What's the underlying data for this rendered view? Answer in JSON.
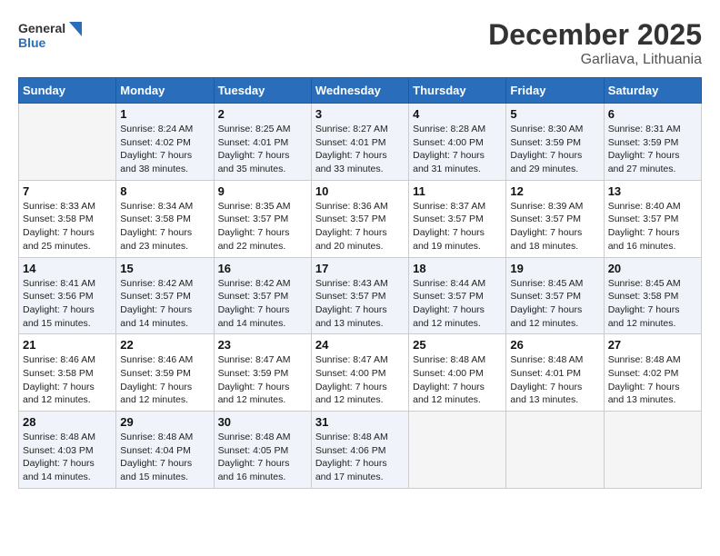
{
  "logo": {
    "line1": "General",
    "line2": "Blue"
  },
  "title": "December 2025",
  "subtitle": "Garliava, Lithuania",
  "headers": [
    "Sunday",
    "Monday",
    "Tuesday",
    "Wednesday",
    "Thursday",
    "Friday",
    "Saturday"
  ],
  "weeks": [
    [
      {
        "day": "",
        "info": ""
      },
      {
        "day": "1",
        "info": "Sunrise: 8:24 AM\nSunset: 4:02 PM\nDaylight: 7 hours\nand 38 minutes."
      },
      {
        "day": "2",
        "info": "Sunrise: 8:25 AM\nSunset: 4:01 PM\nDaylight: 7 hours\nand 35 minutes."
      },
      {
        "day": "3",
        "info": "Sunrise: 8:27 AM\nSunset: 4:01 PM\nDaylight: 7 hours\nand 33 minutes."
      },
      {
        "day": "4",
        "info": "Sunrise: 8:28 AM\nSunset: 4:00 PM\nDaylight: 7 hours\nand 31 minutes."
      },
      {
        "day": "5",
        "info": "Sunrise: 8:30 AM\nSunset: 3:59 PM\nDaylight: 7 hours\nand 29 minutes."
      },
      {
        "day": "6",
        "info": "Sunrise: 8:31 AM\nSunset: 3:59 PM\nDaylight: 7 hours\nand 27 minutes."
      }
    ],
    [
      {
        "day": "7",
        "info": "Sunrise: 8:33 AM\nSunset: 3:58 PM\nDaylight: 7 hours\nand 25 minutes."
      },
      {
        "day": "8",
        "info": "Sunrise: 8:34 AM\nSunset: 3:58 PM\nDaylight: 7 hours\nand 23 minutes."
      },
      {
        "day": "9",
        "info": "Sunrise: 8:35 AM\nSunset: 3:57 PM\nDaylight: 7 hours\nand 22 minutes."
      },
      {
        "day": "10",
        "info": "Sunrise: 8:36 AM\nSunset: 3:57 PM\nDaylight: 7 hours\nand 20 minutes."
      },
      {
        "day": "11",
        "info": "Sunrise: 8:37 AM\nSunset: 3:57 PM\nDaylight: 7 hours\nand 19 minutes."
      },
      {
        "day": "12",
        "info": "Sunrise: 8:39 AM\nSunset: 3:57 PM\nDaylight: 7 hours\nand 18 minutes."
      },
      {
        "day": "13",
        "info": "Sunrise: 8:40 AM\nSunset: 3:57 PM\nDaylight: 7 hours\nand 16 minutes."
      }
    ],
    [
      {
        "day": "14",
        "info": "Sunrise: 8:41 AM\nSunset: 3:56 PM\nDaylight: 7 hours\nand 15 minutes."
      },
      {
        "day": "15",
        "info": "Sunrise: 8:42 AM\nSunset: 3:57 PM\nDaylight: 7 hours\nand 14 minutes."
      },
      {
        "day": "16",
        "info": "Sunrise: 8:42 AM\nSunset: 3:57 PM\nDaylight: 7 hours\nand 14 minutes."
      },
      {
        "day": "17",
        "info": "Sunrise: 8:43 AM\nSunset: 3:57 PM\nDaylight: 7 hours\nand 13 minutes."
      },
      {
        "day": "18",
        "info": "Sunrise: 8:44 AM\nSunset: 3:57 PM\nDaylight: 7 hours\nand 12 minutes."
      },
      {
        "day": "19",
        "info": "Sunrise: 8:45 AM\nSunset: 3:57 PM\nDaylight: 7 hours\nand 12 minutes."
      },
      {
        "day": "20",
        "info": "Sunrise: 8:45 AM\nSunset: 3:58 PM\nDaylight: 7 hours\nand 12 minutes."
      }
    ],
    [
      {
        "day": "21",
        "info": "Sunrise: 8:46 AM\nSunset: 3:58 PM\nDaylight: 7 hours\nand 12 minutes."
      },
      {
        "day": "22",
        "info": "Sunrise: 8:46 AM\nSunset: 3:59 PM\nDaylight: 7 hours\nand 12 minutes."
      },
      {
        "day": "23",
        "info": "Sunrise: 8:47 AM\nSunset: 3:59 PM\nDaylight: 7 hours\nand 12 minutes."
      },
      {
        "day": "24",
        "info": "Sunrise: 8:47 AM\nSunset: 4:00 PM\nDaylight: 7 hours\nand 12 minutes."
      },
      {
        "day": "25",
        "info": "Sunrise: 8:48 AM\nSunset: 4:00 PM\nDaylight: 7 hours\nand 12 minutes."
      },
      {
        "day": "26",
        "info": "Sunrise: 8:48 AM\nSunset: 4:01 PM\nDaylight: 7 hours\nand 13 minutes."
      },
      {
        "day": "27",
        "info": "Sunrise: 8:48 AM\nSunset: 4:02 PM\nDaylight: 7 hours\nand 13 minutes."
      }
    ],
    [
      {
        "day": "28",
        "info": "Sunrise: 8:48 AM\nSunset: 4:03 PM\nDaylight: 7 hours\nand 14 minutes."
      },
      {
        "day": "29",
        "info": "Sunrise: 8:48 AM\nSunset: 4:04 PM\nDaylight: 7 hours\nand 15 minutes."
      },
      {
        "day": "30",
        "info": "Sunrise: 8:48 AM\nSunset: 4:05 PM\nDaylight: 7 hours\nand 16 minutes."
      },
      {
        "day": "31",
        "info": "Sunrise: 8:48 AM\nSunset: 4:06 PM\nDaylight: 7 hours\nand 17 minutes."
      },
      {
        "day": "",
        "info": ""
      },
      {
        "day": "",
        "info": ""
      },
      {
        "day": "",
        "info": ""
      }
    ]
  ]
}
